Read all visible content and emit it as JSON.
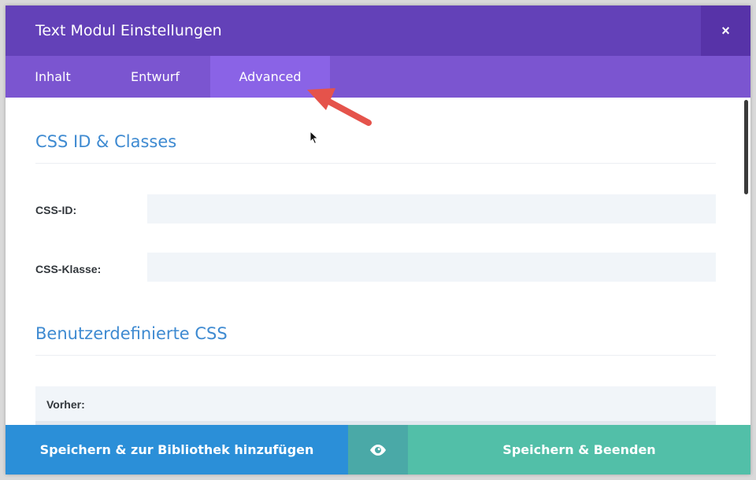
{
  "header": {
    "title": "Text Modul Einstellungen",
    "close_icon": "close-icon",
    "close_glyph": "×"
  },
  "tabs": [
    {
      "label": "Inhalt",
      "active": false
    },
    {
      "label": "Entwurf",
      "active": false
    },
    {
      "label": "Advanced",
      "active": true
    }
  ],
  "sections": {
    "css": {
      "title": "CSS ID & Classes",
      "id_label": "CSS-ID:",
      "id_value": "",
      "class_label": "CSS-Klasse:",
      "class_value": ""
    },
    "custom_css": {
      "title": "Benutzerdefinierte CSS",
      "before_label": "Vorher:"
    }
  },
  "footer": {
    "library_label": "Speichern & zur Bibliothek hinzufügen",
    "preview_icon": "eye-icon",
    "save_label": "Speichern & Beenden"
  },
  "colors": {
    "header": "#6341b8",
    "tabs": "#7b55d0",
    "tab_active": "#8a63e6",
    "section_title": "#3e8ad1",
    "btn_library": "#2b8fd8",
    "btn_preview": "#4aa9a7",
    "btn_save": "#52bfa8",
    "annotation_arrow": "#e5534b"
  }
}
